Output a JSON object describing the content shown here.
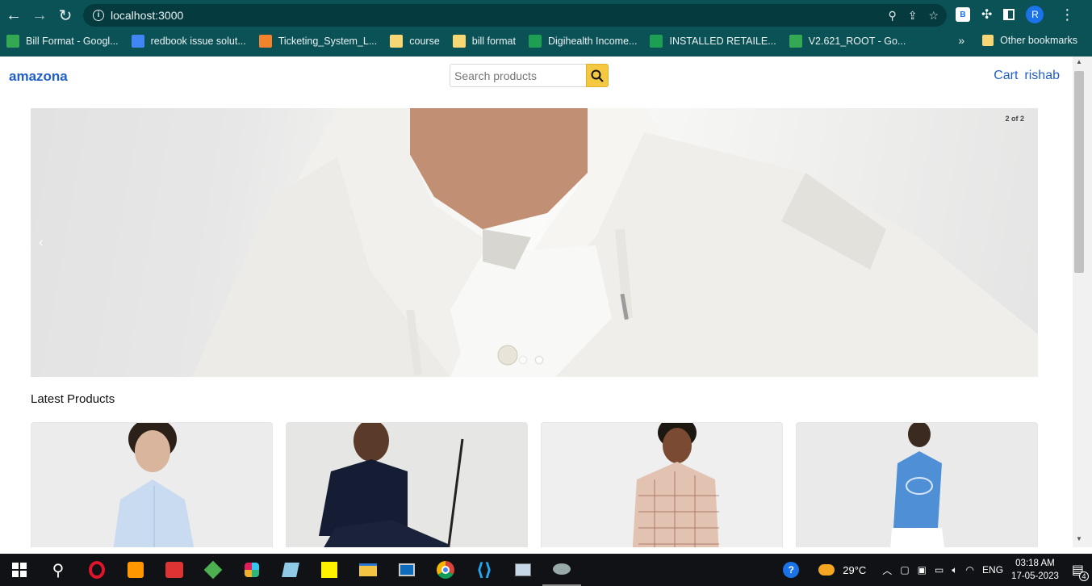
{
  "browser": {
    "url": "localhost:3000",
    "bookmarks": [
      {
        "label": "Bill Format - Googl...",
        "icon": "google-drive-icon",
        "color": "#34a853"
      },
      {
        "label": "redbook issue solut...",
        "icon": "google-docs-icon",
        "color": "#4285f4"
      },
      {
        "label": "Ticketing_System_L...",
        "icon": "slides-icon",
        "color": "#f4812c"
      },
      {
        "label": "course",
        "icon": "folder-icon",
        "color": "#f7d774"
      },
      {
        "label": "bill format",
        "icon": "folder-icon",
        "color": "#f7d774"
      },
      {
        "label": "Digihealth Income...",
        "icon": "sheets-icon",
        "color": "#1e9e52"
      },
      {
        "label": "INSTALLED RETAILE...",
        "icon": "sheets-icon",
        "color": "#1e9e52"
      },
      {
        "label": "V2.621_ROOT - Go...",
        "icon": "google-drive-icon",
        "color": "#34a853"
      }
    ],
    "more_bookmarks": "»",
    "other_bookmarks": "Other bookmarks",
    "profile_initial": "R",
    "ext_label": "B"
  },
  "header": {
    "brand": "amazona",
    "search_placeholder": "Search products",
    "cart_label": "Cart",
    "user_label": "rishab"
  },
  "carousel": {
    "counter": "2 of 2",
    "prev": "‹",
    "slide_count": 2,
    "active_slide": 2
  },
  "products": {
    "title": "Latest Products",
    "items": [
      {
        "image": "light-blue-shirt"
      },
      {
        "image": "navy-polo"
      },
      {
        "image": "checked-shirt"
      },
      {
        "image": "blue-tshirt"
      }
    ]
  },
  "taskbar": {
    "weather": "29°C",
    "language": "ENG",
    "time": "03:18 AM",
    "date": "17-05-2023",
    "notifications": "4"
  }
}
